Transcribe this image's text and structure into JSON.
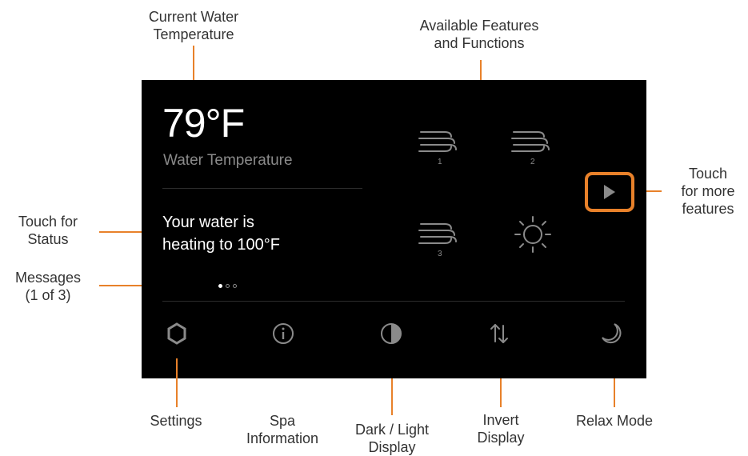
{
  "screen": {
    "temperature": "79°F",
    "temperature_label": "Water Temperature",
    "status_lines": [
      "Your water is",
      "heating to 100°F"
    ],
    "message_page": 1,
    "message_pages_total": 3
  },
  "features": [
    {
      "icon": "jet-1-icon",
      "number": "1"
    },
    {
      "icon": "jet-2-icon",
      "number": "2"
    },
    {
      "icon": "jet-3-icon",
      "number": "3"
    },
    {
      "icon": "light-icon"
    }
  ],
  "more_features_icon": "play-arrow-icon",
  "bottom_bar": [
    {
      "icon": "settings-icon"
    },
    {
      "icon": "info-icon"
    },
    {
      "icon": "contrast-icon"
    },
    {
      "icon": "invert-arrows-icon"
    },
    {
      "icon": "moon-icon"
    }
  ],
  "callouts": {
    "current_water_temperature": [
      "Current Water",
      "Temperature"
    ],
    "available_features": [
      "Available Features",
      "and Functions"
    ],
    "touch_more_features": [
      "Touch",
      "for more",
      "features"
    ],
    "touch_for_status": [
      "Touch for",
      "Status"
    ],
    "messages": [
      "Messages",
      "(1 of 3)"
    ],
    "settings": [
      "Settings"
    ],
    "spa_information": [
      "Spa",
      "Information"
    ],
    "dark_light_display": [
      "Dark / Light",
      "Display"
    ],
    "invert_display": [
      "Invert",
      "Display"
    ],
    "relax_mode": [
      "Relax Mode"
    ]
  },
  "colors": {
    "accent": "#e8812a",
    "screen_background": "#000000",
    "icon_gray": "#8a8a8a"
  }
}
